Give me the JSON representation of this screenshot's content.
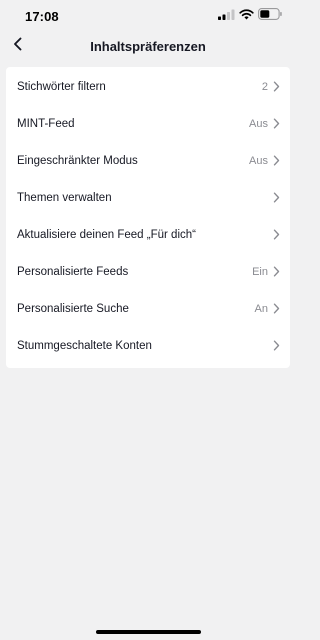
{
  "status_bar": {
    "time": "17:08"
  },
  "header": {
    "title": "Inhaltspräferenzen",
    "back_icon": "chevron-left-icon"
  },
  "settings": [
    {
      "label": "Stichwörter filtern",
      "value": "2"
    },
    {
      "label": "MINT-Feed",
      "value": "Aus"
    },
    {
      "label": "Eingeschränkter Modus",
      "value": "Aus"
    },
    {
      "label": "Themen verwalten",
      "value": ""
    },
    {
      "label": "Aktualisiere deinen Feed „Für dich“",
      "value": ""
    },
    {
      "label": "Personalisierte Feeds",
      "value": "Ein"
    },
    {
      "label": "Personalisierte Suche",
      "value": "An"
    },
    {
      "label": "Stummgeschaltete Konten",
      "value": ""
    }
  ],
  "colors": {
    "background": "#f1f1f2",
    "card": "#ffffff",
    "text": "#161823",
    "secondary_text": "#8a8b91"
  }
}
